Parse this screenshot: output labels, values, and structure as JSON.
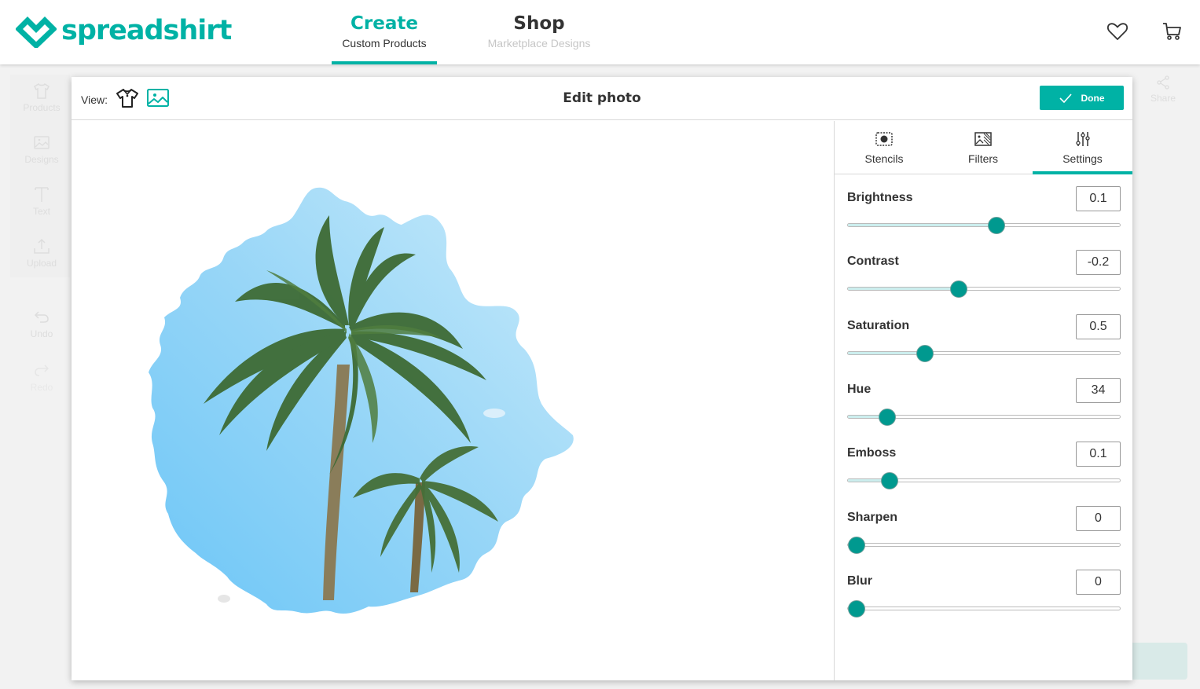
{
  "header": {
    "brand": "spreadshirt",
    "nav": [
      {
        "title": "Create",
        "subtitle": "Custom Products",
        "active": true
      },
      {
        "title": "Shop",
        "subtitle": "Marketplace Designs",
        "active": false
      }
    ],
    "icons": [
      "heart-icon",
      "cart-icon"
    ]
  },
  "sidebar": {
    "items": [
      {
        "label": "Products",
        "icon": "tshirt-icon"
      },
      {
        "label": "Designs",
        "icon": "image-icon"
      },
      {
        "label": "Text",
        "icon": "text-icon"
      },
      {
        "label": "Upload",
        "icon": "upload-icon"
      }
    ],
    "undo_label": "Undo",
    "redo_label": "Redo"
  },
  "share_label": "Share",
  "modal": {
    "view_label": "View:",
    "view_icons": [
      "tshirt-view-icon",
      "image-view-icon"
    ],
    "active_view": "image",
    "title": "Edit photo",
    "done_label": "Done",
    "photo_description": "Palm trees against blue sky in splash-shaped stencil",
    "tabs": [
      {
        "label": "Stencils",
        "icon": "stencil-icon",
        "active": false
      },
      {
        "label": "Filters",
        "icon": "filters-icon",
        "active": false
      },
      {
        "label": "Settings",
        "icon": "sliders-icon",
        "active": true
      }
    ],
    "settings": [
      {
        "label": "Brightness",
        "value": "0.1",
        "fill_fraction": 0.55
      },
      {
        "label": "Contrast",
        "value": "-0.2",
        "fill_fraction": 0.4
      },
      {
        "label": "Saturation",
        "value": "0.5",
        "fill_fraction": 0.27
      },
      {
        "label": "Hue",
        "value": "34",
        "fill_fraction": 0.12
      },
      {
        "label": "Emboss",
        "value": "0.1",
        "fill_fraction": 0.13
      },
      {
        "label": "Sharpen",
        "value": "0",
        "fill_fraction": 0.0
      },
      {
        "label": "Blur",
        "value": "0",
        "fill_fraction": 0.0
      }
    ]
  },
  "colors": {
    "brand": "#00b2a5",
    "slider_thumb": "#00998f",
    "slider_fill": "#cceeee"
  }
}
